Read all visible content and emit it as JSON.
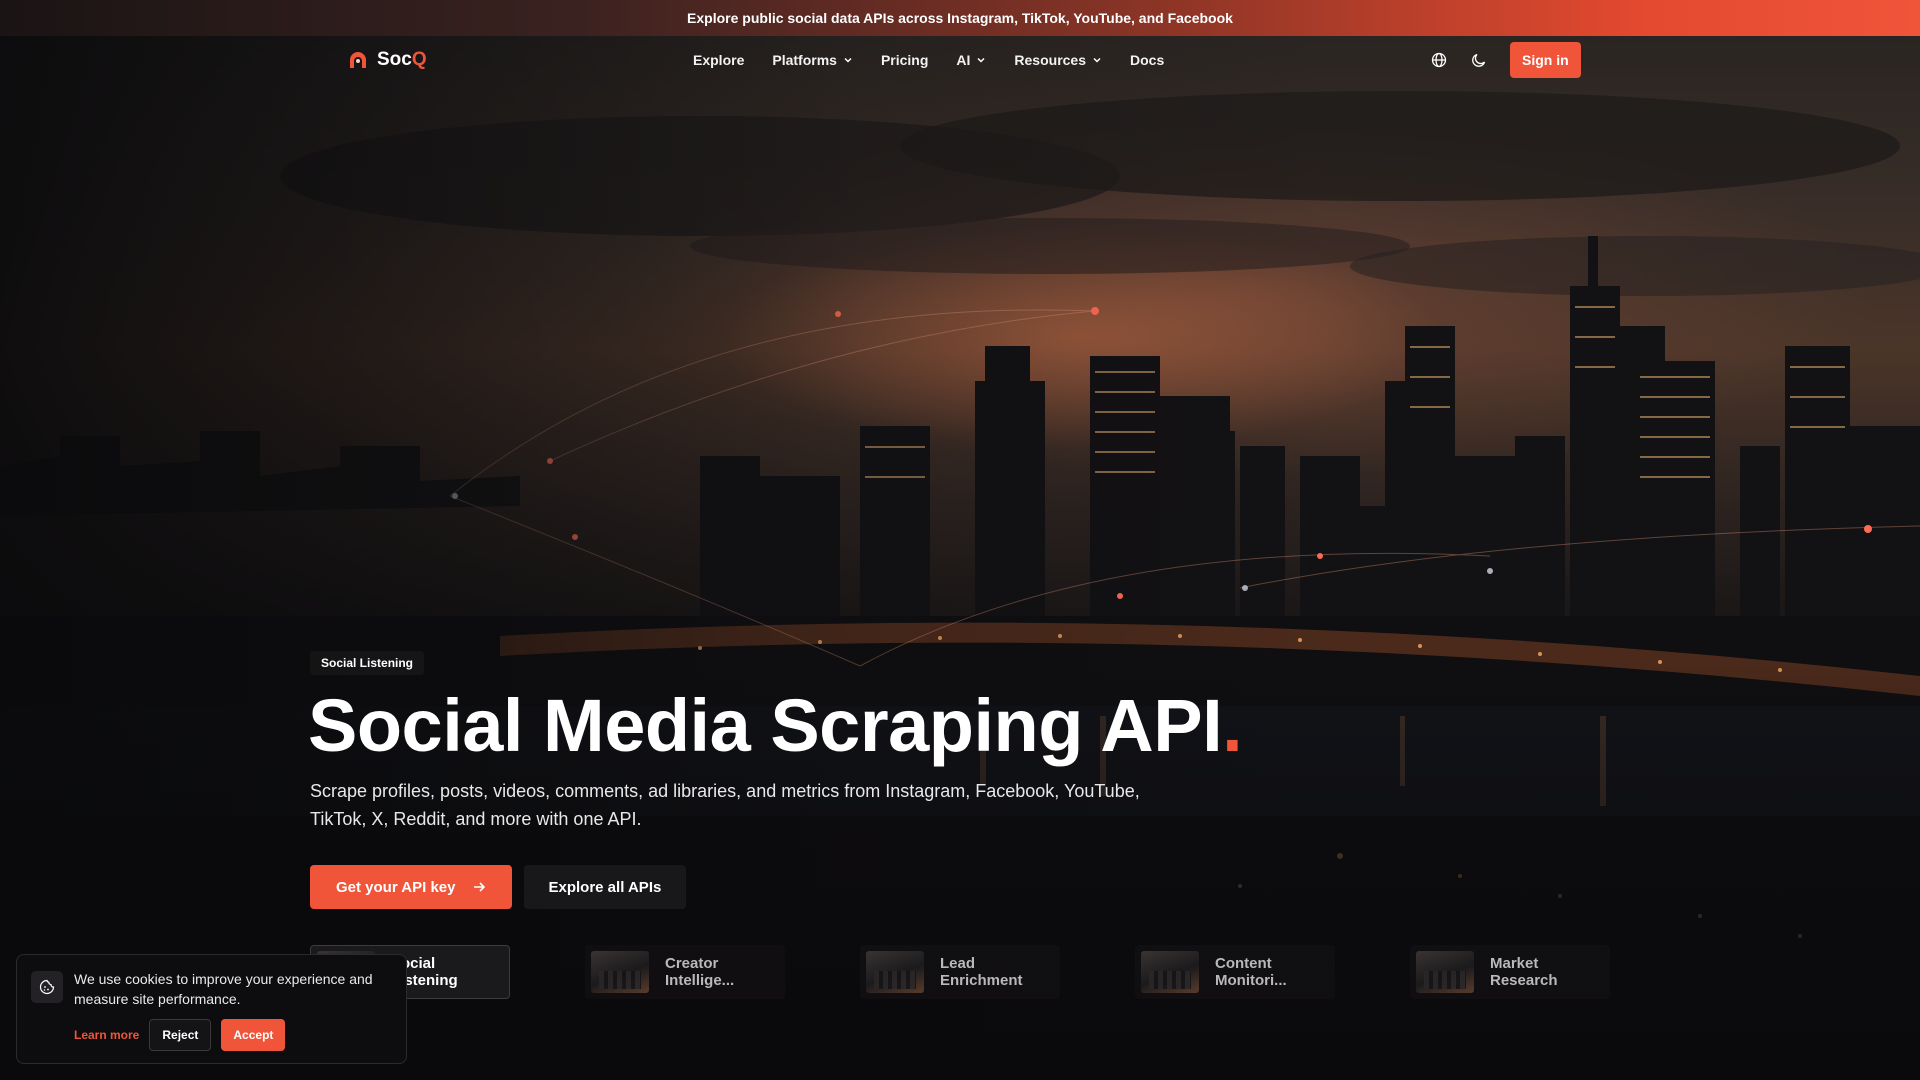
{
  "announcement": {
    "text": "Explore public social data APIs across Instagram, TikTok, YouTube, and Facebook"
  },
  "brand": {
    "name_prefix": "Soc",
    "name_suffix": "Q",
    "accent": "#f0553a",
    "logo_icon": "socq-logo-icon"
  },
  "nav": {
    "links": [
      {
        "label": "Explore",
        "has_dropdown": false
      },
      {
        "label": "Platforms",
        "has_dropdown": true
      },
      {
        "label": "Pricing",
        "has_dropdown": false
      },
      {
        "label": "AI",
        "has_dropdown": true
      },
      {
        "label": "Resources",
        "has_dropdown": true
      },
      {
        "label": "Docs",
        "has_dropdown": false
      }
    ],
    "language_icon": "globe-icon",
    "theme_icon": "moon-icon",
    "signin_label": "Sign in"
  },
  "hero": {
    "badge": "Social Listening",
    "title": "Social Media Scraping API",
    "title_dot": ".",
    "subtitle": "Scrape profiles, posts, videos, comments, ad libraries, and metrics from Instagram, Facebook, YouTube, TikTok, X, Reddit, and more with one API.",
    "primary_cta": "Get your API key",
    "primary_cta_icon": "arrow-right-icon",
    "secondary_cta": "Explore all APIs"
  },
  "usecases": [
    {
      "label": "Social Listening",
      "active": true
    },
    {
      "label": "Creator Intellige...",
      "active": false
    },
    {
      "label": "Lead Enrichment",
      "active": false
    },
    {
      "label": "Content Monitori...",
      "active": false
    },
    {
      "label": "Market Research",
      "active": false
    }
  ],
  "cookie": {
    "icon": "cookie-icon",
    "text": "We use cookies to improve your experience and measure site performance.",
    "learn_more": "Learn more",
    "reject": "Reject",
    "accept": "Accept"
  }
}
